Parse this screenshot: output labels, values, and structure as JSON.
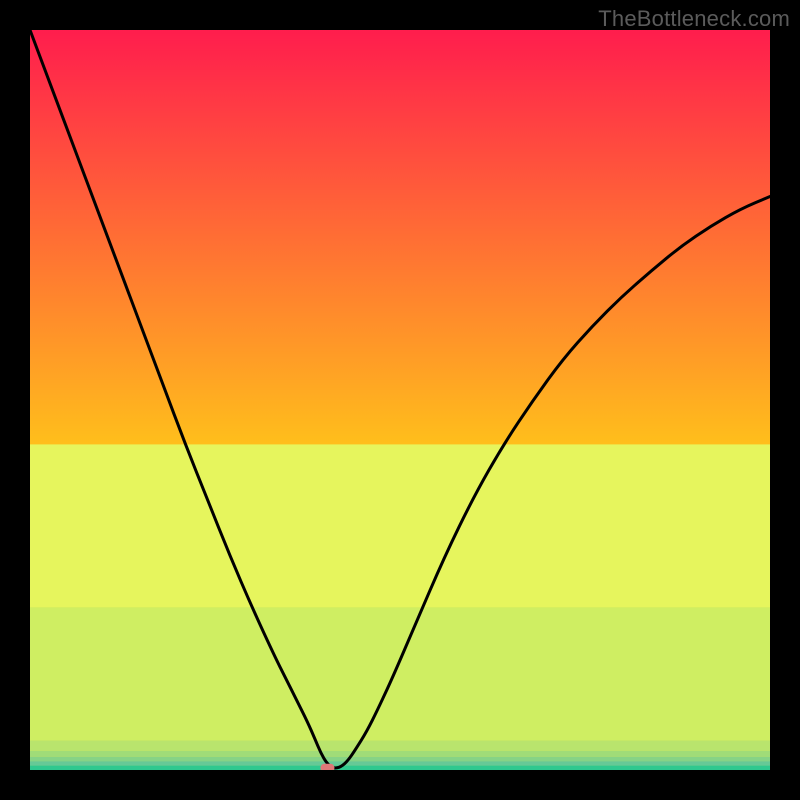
{
  "watermark": "TheBottleneck.com",
  "chart_data": {
    "type": "line",
    "title": "",
    "xlabel": "",
    "ylabel": "",
    "xlim": [
      0,
      100
    ],
    "ylim": [
      0,
      100
    ],
    "x": [
      0,
      3,
      6,
      9,
      12,
      15,
      18,
      21,
      24,
      27,
      30,
      33,
      34.5,
      36,
      37.5,
      38.5,
      39.3,
      40.1,
      41,
      42,
      43,
      44,
      45.5,
      47,
      49,
      52,
      56,
      60,
      64,
      68,
      72,
      76,
      80,
      84,
      88,
      92,
      96,
      100
    ],
    "values": [
      100,
      92,
      84,
      76,
      68,
      60,
      52,
      44,
      36.5,
      29,
      22,
      15.5,
      12.5,
      9.5,
      6.5,
      4.2,
      2.3,
      0.9,
      0.2,
      0.4,
      1.3,
      2.8,
      5.2,
      8.2,
      12.5,
      19.5,
      28.8,
      37,
      44,
      50,
      55.5,
      60,
      64,
      67.5,
      70.8,
      73.5,
      75.8,
      77.5
    ],
    "marker": {
      "x": 40.2,
      "y": 0.3
    },
    "bottom_bands": [
      {
        "y": 22,
        "height": 22,
        "color": "#e6f55d"
      },
      {
        "y": 4.0,
        "height": 18,
        "color": "#cfee62"
      },
      {
        "y": 2.6,
        "height": 1.4,
        "color": "#b9e46d"
      },
      {
        "y": 1.8,
        "height": 0.8,
        "color": "#a0dc78"
      },
      {
        "y": 1.2,
        "height": 0.6,
        "color": "#86d386"
      },
      {
        "y": 0.6,
        "height": 0.6,
        "color": "#66c997"
      },
      {
        "y": 0.0,
        "height": 0.6,
        "color": "#2fc88f"
      }
    ],
    "gradient_top": "#ff1d4d",
    "gradient_mid": "#ffca18"
  }
}
